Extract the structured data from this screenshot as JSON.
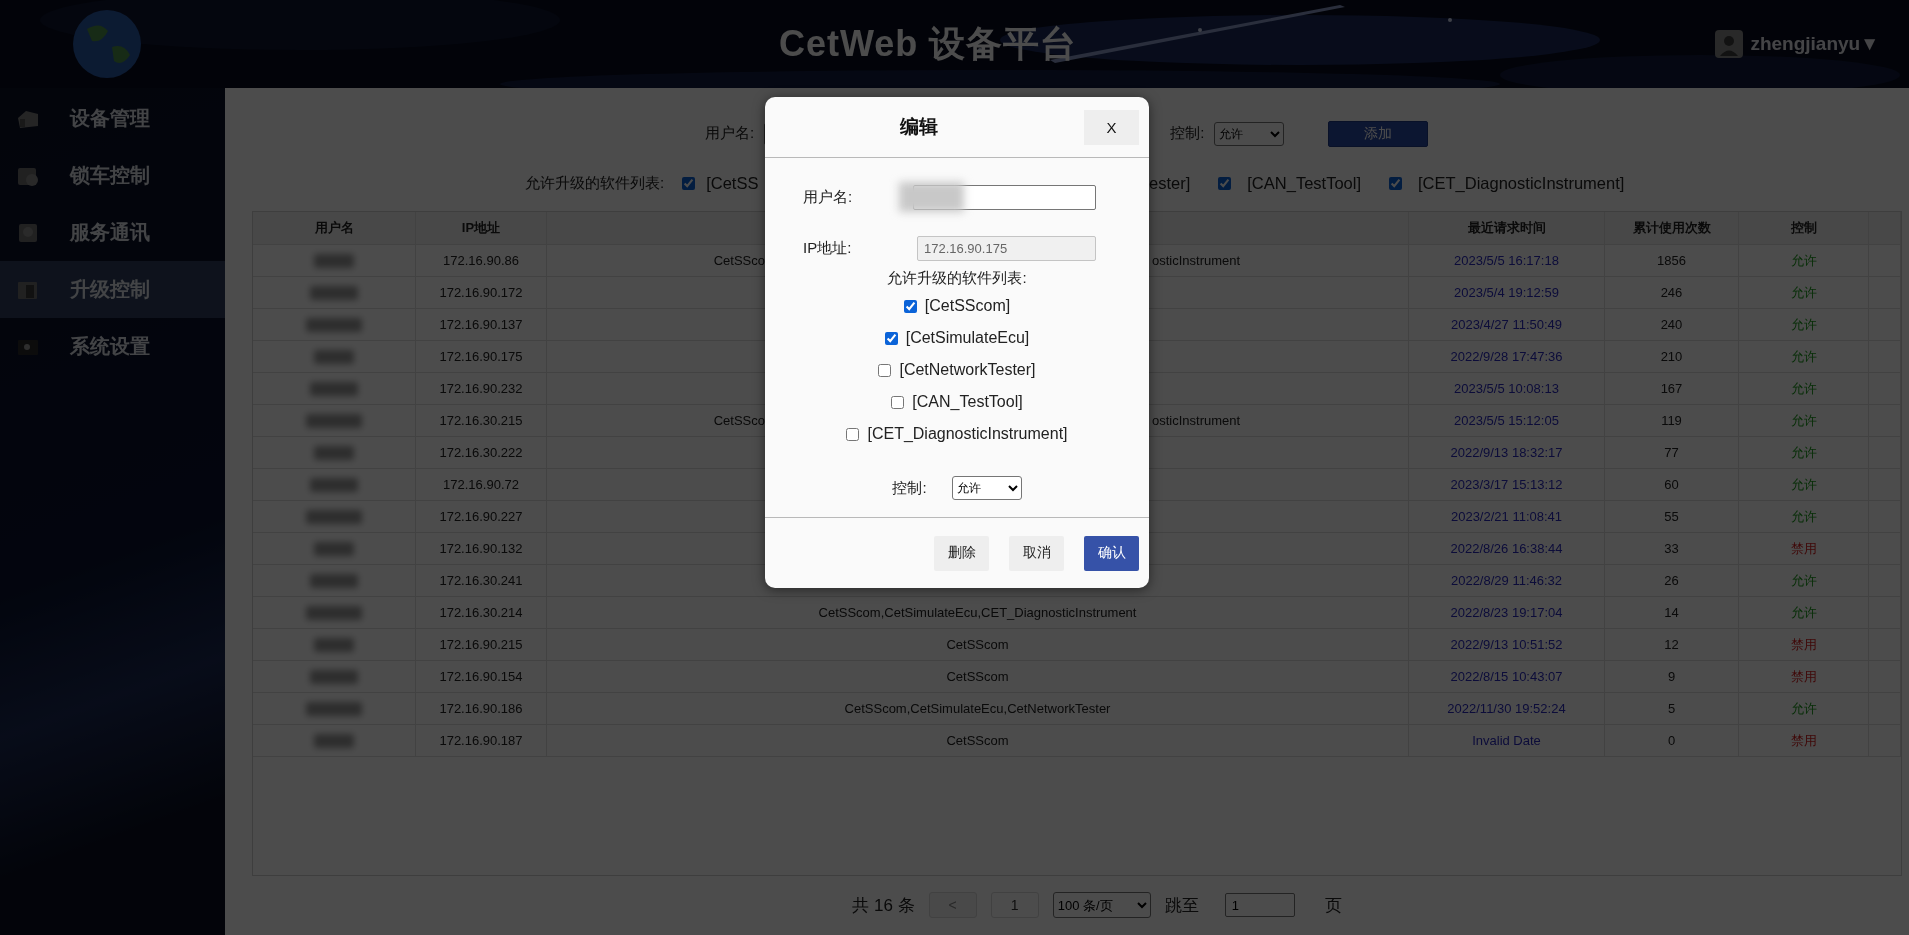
{
  "header": {
    "title": "CetWeb 设备平台",
    "user": "zhengjianyu▼"
  },
  "sidebar": {
    "items": [
      {
        "label": "设备管理",
        "selected": false
      },
      {
        "label": "锁车控制",
        "selected": false
      },
      {
        "label": "服务通讯",
        "selected": false
      },
      {
        "label": "升级控制",
        "selected": true
      },
      {
        "label": "系统设置",
        "selected": false
      }
    ]
  },
  "filter": {
    "username_label": "用户名:",
    "control_label": "控制:",
    "control_value": "允许",
    "add_button": "添加",
    "software_label": "允许升级的软件列表:",
    "software": [
      {
        "kind": "check",
        "label": "[CetSS",
        "checked": true
      },
      {
        "kind": "text",
        "label": "ester]"
      },
      {
        "kind": "check",
        "label": "[CAN_TestTool]",
        "checked": true
      },
      {
        "kind": "check",
        "label": "[CET_DiagnosticInstrument]",
        "checked": true
      }
    ]
  },
  "table": {
    "columns": [
      "用户名",
      "IP地址",
      "",
      "最近请求时间",
      "累计使用次数",
      "控制"
    ],
    "rows": [
      {
        "ip": "172.16.90.86",
        "software_head": "CetSSco",
        "software_tail": "osticInstrument",
        "time": "2023/5/5 16:17:18",
        "count": "1856",
        "control": "允许",
        "kind": "allow"
      },
      {
        "ip": "172.16.90.172",
        "time": "2023/5/4 19:12:59",
        "count": "246",
        "control": "允许",
        "kind": "allow"
      },
      {
        "ip": "172.16.90.137",
        "time": "2023/4/27 11:50:49",
        "count": "240",
        "control": "允许",
        "kind": "allow"
      },
      {
        "ip": "172.16.90.175",
        "time": "2022/9/28 17:47:36",
        "count": "210",
        "control": "允许",
        "kind": "allow"
      },
      {
        "ip": "172.16.90.232",
        "time": "2023/5/5 10:08:13",
        "count": "167",
        "control": "允许",
        "kind": "allow"
      },
      {
        "ip": "172.16.30.215",
        "software_head": "CetSSco",
        "software_tail": "osticInstrument",
        "time": "2023/5/5 15:12:05",
        "count": "119",
        "control": "允许",
        "kind": "allow"
      },
      {
        "ip": "172.16.30.222",
        "time": "2022/9/13 18:32:17",
        "count": "77",
        "control": "允许",
        "kind": "allow"
      },
      {
        "ip": "172.16.90.72",
        "time": "2023/3/17 15:13:12",
        "count": "60",
        "control": "允许",
        "kind": "allow"
      },
      {
        "ip": "172.16.90.227",
        "time": "2023/2/21 11:08:41",
        "count": "55",
        "control": "允许",
        "kind": "allow"
      },
      {
        "ip": "172.16.90.132",
        "time": "2022/8/26 16:38:44",
        "count": "33",
        "control": "禁用",
        "kind": "deny"
      },
      {
        "ip": "172.16.30.241",
        "time": "2022/8/29 11:46:32",
        "count": "26",
        "control": "允许",
        "kind": "allow"
      },
      {
        "ip": "172.16.30.214",
        "software": "CetSScom,CetSimulateEcu,CET_DiagnosticInstrument",
        "time": "2022/8/23 19:17:04",
        "count": "14",
        "control": "允许",
        "kind": "allow"
      },
      {
        "ip": "172.16.90.215",
        "software": "CetSScom",
        "time": "2022/9/13 10:51:52",
        "count": "12",
        "control": "禁用",
        "kind": "deny"
      },
      {
        "ip": "172.16.90.154",
        "software": "CetSScom",
        "time": "2022/8/15 10:43:07",
        "count": "9",
        "control": "禁用",
        "kind": "deny"
      },
      {
        "ip": "172.16.90.186",
        "software": "CetSScom,CetSimulateEcu,CetNetworkTester",
        "time": "2022/11/30 19:52:24",
        "count": "5",
        "control": "允许",
        "kind": "allow"
      },
      {
        "ip": "172.16.90.187",
        "software": "CetSScom",
        "time": "Invalid Date",
        "count": "0",
        "control": "禁用",
        "kind": "deny"
      }
    ]
  },
  "pagination": {
    "total": "共 16 条",
    "prev": "<",
    "prev_disabled": true,
    "page": "1",
    "page_size": "100 条/页",
    "jump_label": "跳至",
    "jump_value": "1",
    "page_suffix": "页"
  },
  "dialog": {
    "title": "编辑",
    "close": "X",
    "username_label": "用户名:",
    "ip_label": "IP地址:",
    "ip_value": "172.16.90.175",
    "ip_disabled": true,
    "software_label": "允许升级的软件列表:",
    "software": [
      {
        "label": "[CetSScom]",
        "checked": true
      },
      {
        "label": "[CetSimulateEcu]",
        "checked": true
      },
      {
        "label": "[CetNetworkTester]",
        "checked": false
      },
      {
        "label": "[CAN_TestTool]",
        "checked": false
      },
      {
        "label": "[CET_DiagnosticInstrument]",
        "checked": false
      }
    ],
    "control_label": "控制:",
    "control_value": "允许",
    "buttons": [
      {
        "label": "删除",
        "kind": "plain"
      },
      {
        "label": "取消",
        "kind": "plain"
      },
      {
        "label": "确认",
        "kind": "primary"
      }
    ]
  }
}
